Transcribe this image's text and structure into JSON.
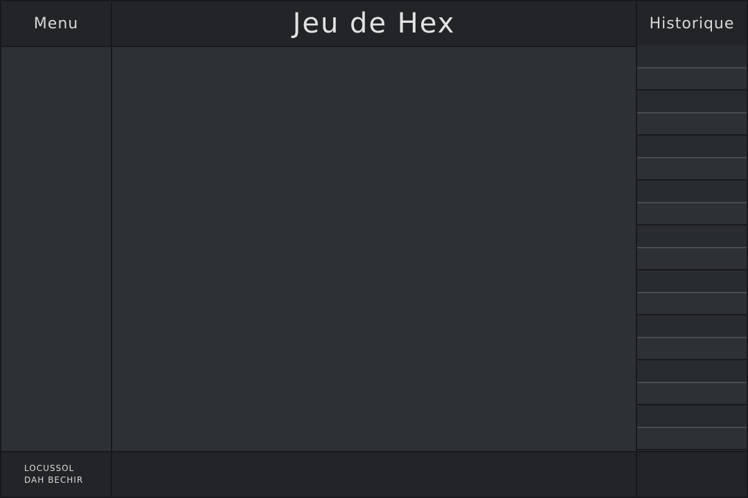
{
  "header": {
    "menu_label": "Menu",
    "title": "Jeu de Hex",
    "history_label": "Historique"
  },
  "history": {
    "rows": 18
  },
  "footer": {
    "authors": [
      "LOCUSSOL",
      "DAH BECHIR"
    ]
  },
  "colors": {
    "background_dark": "#222428",
    "panel": "#2e3134",
    "border": "#17191c",
    "text": "#d8d8d8"
  }
}
